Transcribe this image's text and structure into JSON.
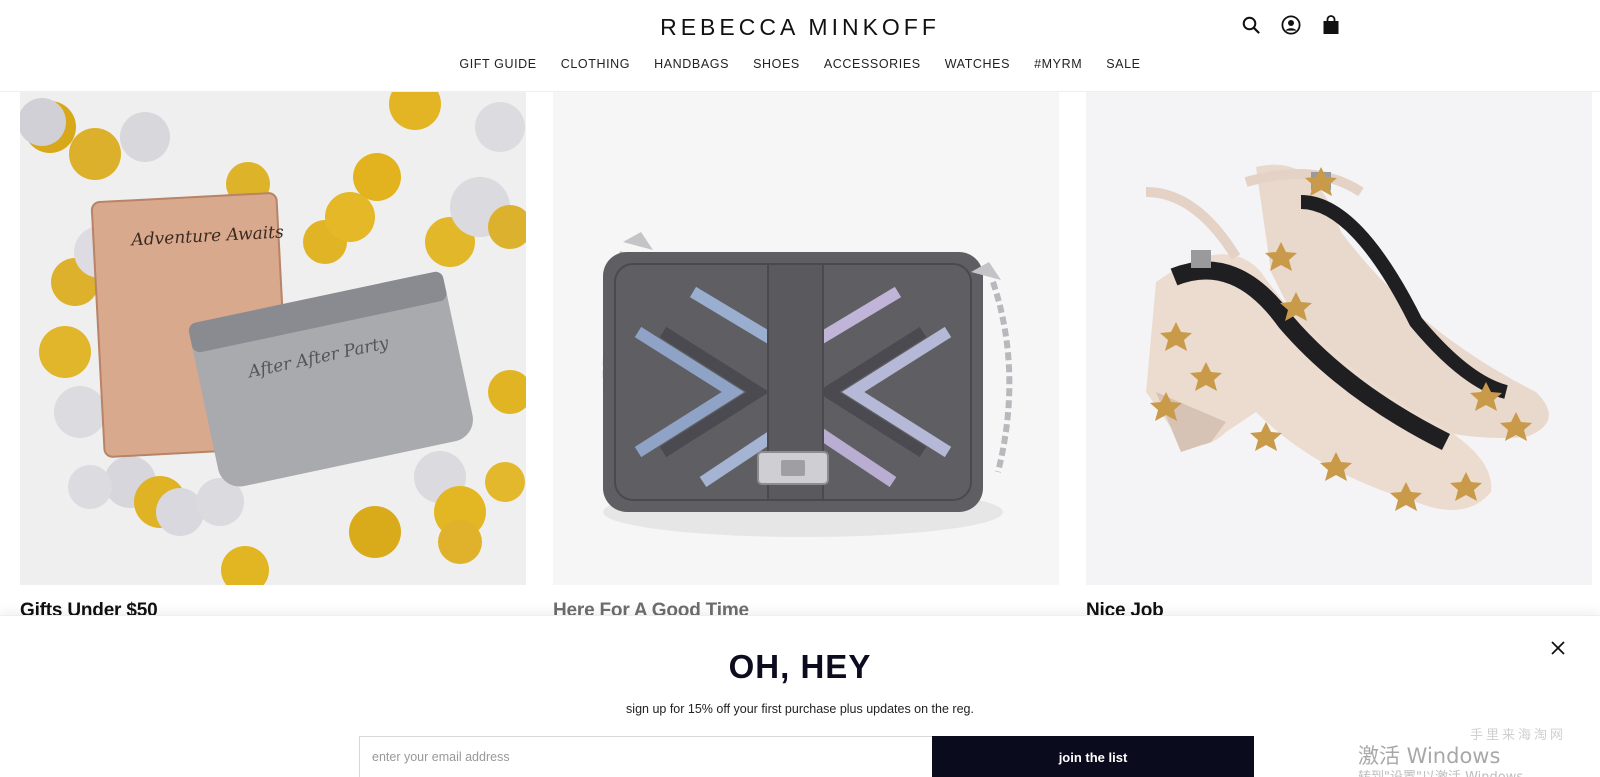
{
  "brand": {
    "logo_text": "REBECCA MINKOFF"
  },
  "header": {
    "icons": [
      "search-icon",
      "account-icon",
      "shopping-bag-icon"
    ]
  },
  "nav": {
    "items": [
      {
        "label": "GIFT GUIDE"
      },
      {
        "label": "CLOTHING"
      },
      {
        "label": "HANDBAGS"
      },
      {
        "label": "SHOES"
      },
      {
        "label": "ACCESSORIES"
      },
      {
        "label": "WATCHES"
      },
      {
        "label": "#MYRM"
      },
      {
        "label": "SALE"
      }
    ]
  },
  "products": [
    {
      "title": "Gifts Under $50",
      "image": "passport-case-and-pouch-with-confetti"
    },
    {
      "title": "Here For A Good Time",
      "image": "quilted-chevron-crossbody-bag"
    },
    {
      "title": "Nice Job",
      "image": "star-print-ankle-strap-pumps"
    }
  ],
  "product_art": {
    "passport_text": "Adventure Awaits",
    "pouch_text": "After After Party"
  },
  "popup": {
    "heading": "OH, HEY",
    "subtext": "sign up for 15% off your first purchase plus updates on the reg.",
    "email_placeholder": "enter your email address",
    "submit_label": "join the list",
    "close_icon": "close-icon"
  },
  "watermark": {
    "line1": "激活 Windows",
    "line2": "手里来海淘网",
    "line3": "转到\"设置\"以激活 Windows。"
  },
  "colors": {
    "primary_dark": "#0b0b1e",
    "text": "#111111",
    "border": "#d8d8d8"
  }
}
